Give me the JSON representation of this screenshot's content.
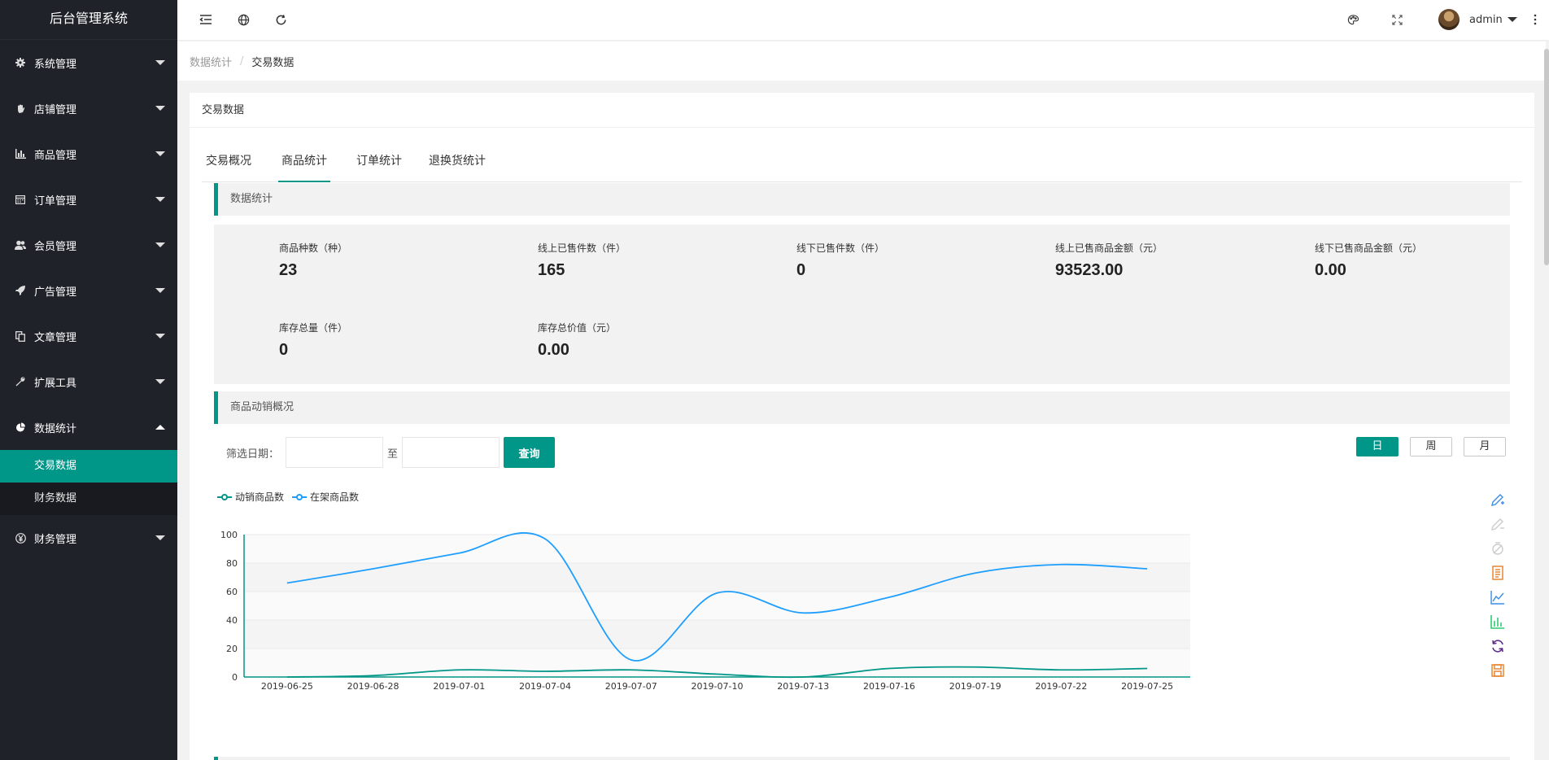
{
  "app": {
    "title": "后台管理系统"
  },
  "sidebar": {
    "items": [
      {
        "label": "系统管理",
        "icon": "gear-icon"
      },
      {
        "label": "店铺管理",
        "icon": "hand-icon"
      },
      {
        "label": "商品管理",
        "icon": "bar-chart-icon"
      },
      {
        "label": "订单管理",
        "icon": "calendar-icon"
      },
      {
        "label": "会员管理",
        "icon": "users-icon"
      },
      {
        "label": "广告管理",
        "icon": "rocket-icon"
      },
      {
        "label": "文章管理",
        "icon": "copy-icon"
      },
      {
        "label": "扩展工具",
        "icon": "wrench-icon"
      },
      {
        "label": "数据统计",
        "icon": "pie-chart-icon"
      },
      {
        "label": "财务管理",
        "icon": "yen-icon"
      }
    ],
    "sub_items": [
      {
        "label": "交易数据"
      },
      {
        "label": "财务数据"
      }
    ]
  },
  "header": {
    "user_name": "admin"
  },
  "breadcrumb": {
    "parent": "数据统计",
    "separator": "/",
    "current": "交易数据"
  },
  "card": {
    "title": "交易数据"
  },
  "tabs": [
    {
      "label": "交易概况"
    },
    {
      "label": "商品统计"
    },
    {
      "label": "订单统计"
    },
    {
      "label": "退换货统计"
    }
  ],
  "sections": {
    "data_stats": "数据统计",
    "sales_overview": "商品动销概况"
  },
  "stats": [
    {
      "label": "商品种数（种）",
      "value": "23"
    },
    {
      "label": "线上已售件数（件）",
      "value": "165"
    },
    {
      "label": "线下已售件数（件）",
      "value": "0"
    },
    {
      "label": "线上已售商品金额（元）",
      "value": "93523.00"
    },
    {
      "label": "线下已售商品金额（元）",
      "value": "0.00"
    },
    {
      "label": "库存总量（件）",
      "value": "0"
    },
    {
      "label": "库存总价值（元）",
      "value": "0.00"
    }
  ],
  "filter": {
    "label": "筛选日期：",
    "to": "至",
    "query_button": "查询",
    "start_value": "",
    "end_value": ""
  },
  "periods": [
    {
      "label": "日"
    },
    {
      "label": "周"
    },
    {
      "label": "月"
    }
  ],
  "toolbox": [
    {
      "icon": "mark-icon",
      "color": "#3a8ee6"
    },
    {
      "icon": "mark-undo-icon",
      "color": "#cccccc"
    },
    {
      "icon": "mark-clear-icon",
      "color": "#cccccc"
    },
    {
      "icon": "data-view-icon",
      "color": "#e67e22"
    },
    {
      "icon": "line-chart-icon",
      "color": "#3a8ee6"
    },
    {
      "icon": "bar-chart-icon",
      "color": "#2ecc71"
    },
    {
      "icon": "restore-icon",
      "color": "#5b2c8a"
    },
    {
      "icon": "save-image-icon",
      "color": "#e67e22"
    }
  ],
  "chart_data": {
    "type": "line",
    "x": [
      "2019-06-25",
      "2019-06-28",
      "2019-07-01",
      "2019-07-04",
      "2019-07-07",
      "2019-07-10",
      "2019-07-13",
      "2019-07-16",
      "2019-07-19",
      "2019-07-22",
      "2019-07-25"
    ],
    "series": [
      {
        "name": "动销商品数",
        "color": "#009688",
        "values": [
          0,
          1,
          5,
          4,
          5,
          2,
          0,
          6,
          7,
          5,
          6
        ]
      },
      {
        "name": "在架商品数",
        "color": "#1e9fff",
        "values": [
          66,
          76,
          87,
          97,
          12,
          59,
          45,
          56,
          73,
          79,
          76
        ]
      }
    ],
    "ylim": [
      0,
      100
    ],
    "yticks": [
      0,
      20,
      40,
      60,
      80,
      100
    ],
    "grid": true,
    "legend": "top-left"
  }
}
